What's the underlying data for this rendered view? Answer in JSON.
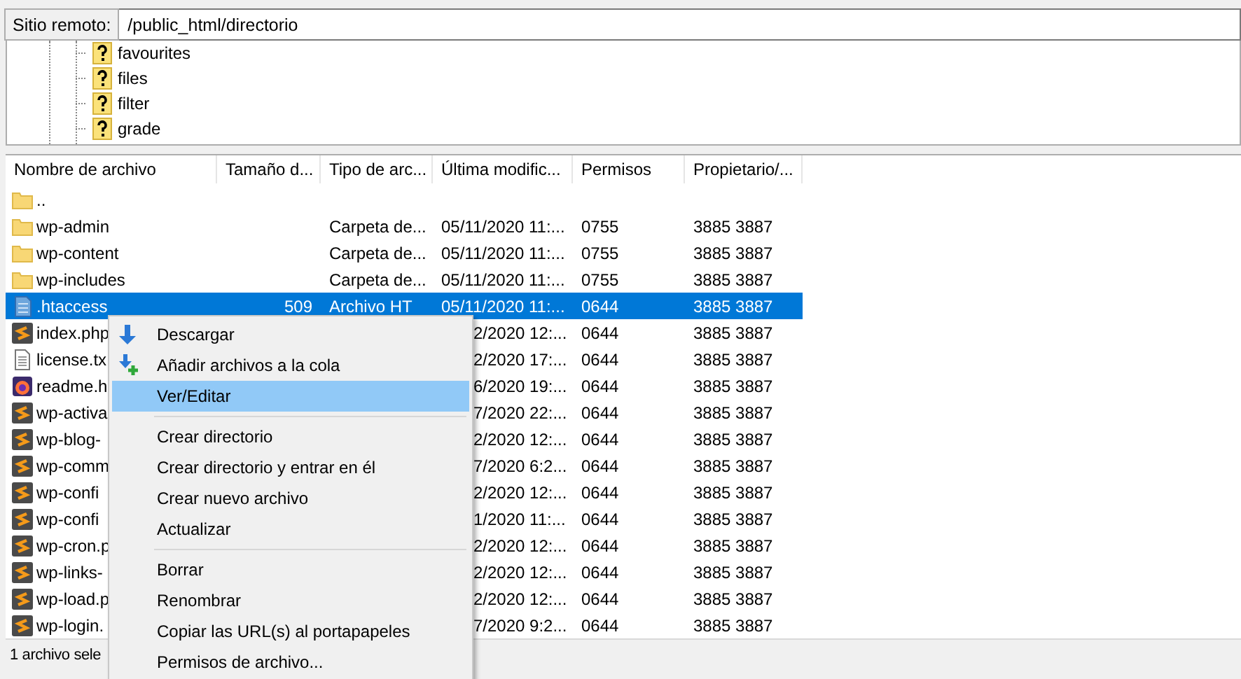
{
  "remote_site": {
    "label": "Sitio remoto:",
    "value": "/public_html/directorio"
  },
  "tree": {
    "items": [
      {
        "name": "favourites"
      },
      {
        "name": "files"
      },
      {
        "name": "filter"
      },
      {
        "name": "grade"
      }
    ]
  },
  "table": {
    "columns": [
      "Nombre de archivo",
      "Tamaño d...",
      "Tipo de arc...",
      "Última modific...",
      "Permisos",
      "Propietario/..."
    ],
    "rows": [
      {
        "kind": "folder",
        "name": "..",
        "selected": false
      },
      {
        "kind": "folder",
        "name": "wp-admin",
        "type": "Carpeta de...",
        "modified": "05/11/2020 11:...",
        "permissions": "0755",
        "owner": "3885 3887",
        "selected": false
      },
      {
        "kind": "folder",
        "name": "wp-content",
        "type": "Carpeta de...",
        "modified": "05/11/2020 11:...",
        "permissions": "0755",
        "owner": "3885 3887",
        "selected": false
      },
      {
        "kind": "folder",
        "name": "wp-includes",
        "type": "Carpeta de...",
        "modified": "05/11/2020 11:...",
        "permissions": "0755",
        "owner": "3885 3887",
        "selected": false
      },
      {
        "kind": "config",
        "name": ".htaccess",
        "size": "509",
        "type": "Archivo HT",
        "modified": "05/11/2020 11:...",
        "permissions": "0644",
        "owner": "3885 3887",
        "selected": true
      },
      {
        "kind": "code",
        "name": "index.php",
        "modified": "2/2020 12:...",
        "permissions": "0644",
        "owner": "3885 3887",
        "selected": false
      },
      {
        "kind": "text",
        "name": "license.tx",
        "modified": "2/2020 17:...",
        "permissions": "0644",
        "owner": "3885 3887",
        "selected": false
      },
      {
        "kind": "web",
        "name": "readme.h",
        "modified": "6/2020 19:...",
        "permissions": "0644",
        "owner": "3885 3887",
        "selected": false
      },
      {
        "kind": "code",
        "name": "wp-activa",
        "modified": "7/2020 22:...",
        "permissions": "0644",
        "owner": "3885 3887",
        "selected": false
      },
      {
        "kind": "code",
        "name": "wp-blog-",
        "modified": "2/2020 12:...",
        "permissions": "0644",
        "owner": "3885 3887",
        "selected": false
      },
      {
        "kind": "code",
        "name": "wp-comm",
        "modified": "7/2020 6:2...",
        "permissions": "0644",
        "owner": "3885 3887",
        "selected": false
      },
      {
        "kind": "code",
        "name": "wp-confi",
        "modified": "2/2020 12:...",
        "permissions": "0644",
        "owner": "3885 3887",
        "selected": false
      },
      {
        "kind": "code",
        "name": "wp-confi",
        "modified": "1/2020 11:...",
        "permissions": "0644",
        "owner": "3885 3887",
        "selected": false
      },
      {
        "kind": "code",
        "name": "wp-cron.p",
        "modified": "2/2020 12:...",
        "permissions": "0644",
        "owner": "3885 3887",
        "selected": false
      },
      {
        "kind": "code",
        "name": "wp-links-",
        "modified": "2/2020 12:...",
        "permissions": "0644",
        "owner": "3885 3887",
        "selected": false
      },
      {
        "kind": "code",
        "name": "wp-load.p",
        "modified": "2/2020 12:...",
        "permissions": "0644",
        "owner": "3885 3887",
        "selected": false
      },
      {
        "kind": "code",
        "name": "wp-login.",
        "modified": "7/2020 9:2...",
        "permissions": "0644",
        "owner": "3885 3887",
        "selected": false
      }
    ]
  },
  "status_bar": "1 archivo sele",
  "context_menu": {
    "groups": [
      [
        {
          "label": "Descargar",
          "kind": "download",
          "selected": false
        },
        {
          "label": "Añadir archivos a la cola",
          "kind": "queue",
          "selected": false
        },
        {
          "label": "Ver/Editar",
          "selected": true
        }
      ],
      [
        {
          "label": "Crear directorio",
          "selected": false
        },
        {
          "label": "Crear directorio y entrar en él",
          "selected": false
        },
        {
          "label": "Crear nuevo archivo",
          "selected": false
        },
        {
          "label": "Actualizar",
          "selected": false
        }
      ],
      [
        {
          "label": "Borrar",
          "selected": false
        },
        {
          "label": "Renombrar",
          "selected": false
        },
        {
          "label": "Copiar las URL(s) al portapapeles",
          "selected": false
        },
        {
          "label": "Permisos de archivo...",
          "selected": false
        }
      ]
    ]
  }
}
